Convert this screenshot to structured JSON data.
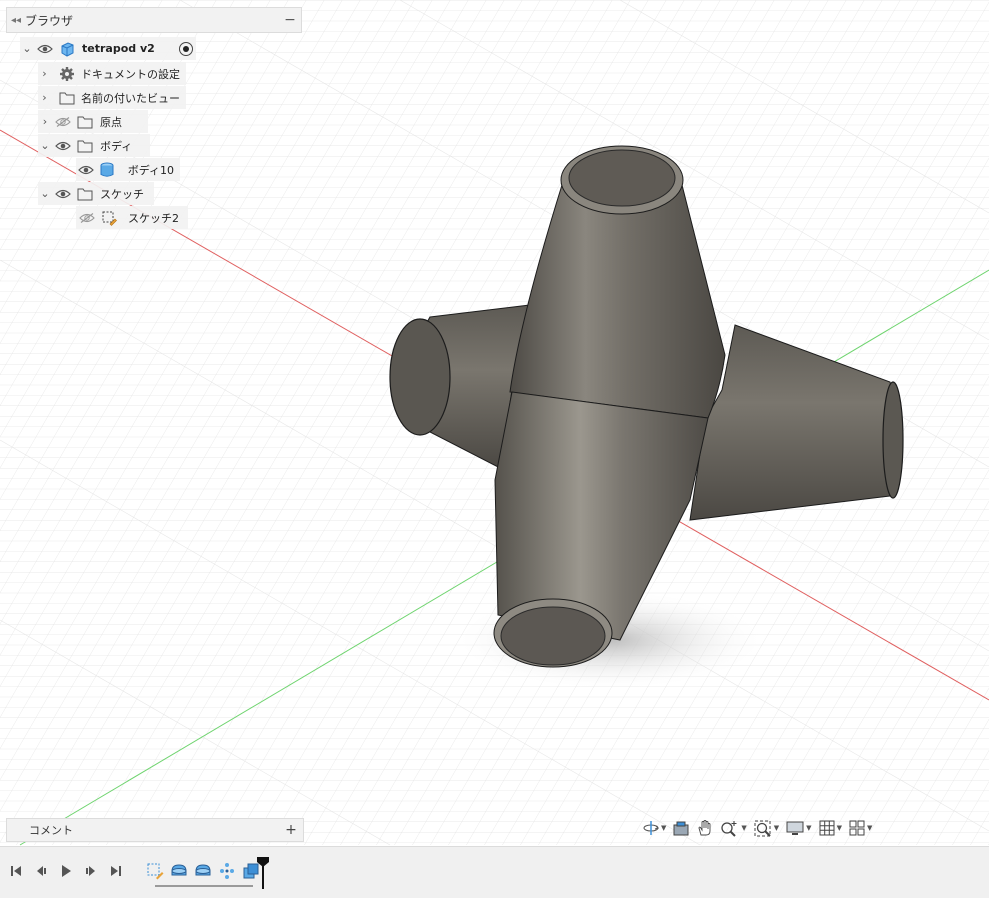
{
  "browser": {
    "title": "ブラウザ",
    "root": {
      "label": "tetrapod v2"
    },
    "items": [
      {
        "label": "ドキュメントの設定",
        "icon": "gear-icon"
      },
      {
        "label": "名前の付いたビュー",
        "icon": "folder-icon"
      },
      {
        "label": "原点",
        "icon": "folder-icon",
        "visible": false
      },
      {
        "label": "ボディ",
        "icon": "folder-icon",
        "expanded": true
      },
      {
        "label": "ボディ10",
        "icon": "body-icon"
      },
      {
        "label": "スケッチ",
        "icon": "folder-icon",
        "expanded": true
      },
      {
        "label": "スケッチ2",
        "icon": "sketch-icon",
        "visible": false
      }
    ]
  },
  "comments": {
    "title": "コメント",
    "add_label": "+"
  },
  "colors": {
    "x_axis": "#e06060",
    "y_axis": "#6fd46f",
    "model": "#6f6b64",
    "accent": "#3d8fd6"
  }
}
